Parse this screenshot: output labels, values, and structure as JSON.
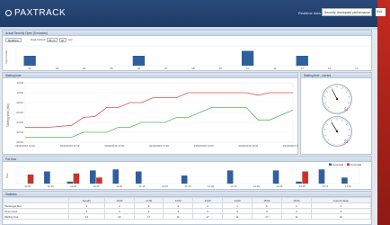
{
  "app": {
    "title": "PAXTRACK"
  },
  "header": {
    "realtime_label": "Realtime data",
    "select_value": "Security checkpoint performance",
    "exit_label": "Exit"
  },
  "controls": {
    "button_label": "Realtime",
    "time_label": "Data refresh",
    "time_value": "08:46",
    "interval_value": "60",
    "unit_label": "sec"
  },
  "panels": {
    "top_bar_title": "Actual Security Open (5 minutes)",
    "waiting_title": "Waiting time",
    "gauge_title": "Waiting time - current",
    "pax_title": "Pax flow",
    "stats_title": "Statistics"
  },
  "top_bar_chart": {
    "type": "bar",
    "ylabel": "Open lanes",
    "categories": [
      "02",
      "03",
      "04",
      "05",
      "06",
      "07",
      "08",
      "09",
      "10",
      "11",
      "12",
      "13",
      "14"
    ],
    "values": [
      4,
      0,
      0,
      0,
      4,
      0,
      0,
      0,
      6,
      0,
      4,
      0,
      0
    ],
    "ylim": [
      0,
      8
    ]
  },
  "waiting_chart": {
    "type": "line",
    "ylabel": "Waiting time (min)",
    "yticks": [
      "12:00",
      "10:00",
      "08:00",
      "06:00",
      "04:00",
      "02:00",
      "00:00"
    ],
    "xticks": [
      "03/02/2015 10:00",
      "03/02/2015 11:00",
      "03/02/2015 12:00",
      "03/02/2015 13:00",
      "03/02/2015 14:00",
      "03/02/2015 15:00",
      "03/02/2015 16:00"
    ],
    "ylim": [
      0,
      12
    ],
    "series": [
      {
        "color": "#d9534f",
        "values": [
          3,
          3,
          3,
          3.2,
          3.4,
          5,
          5.2,
          7,
          7,
          8,
          8,
          9,
          9,
          9,
          10,
          10,
          10,
          10,
          10,
          10,
          9.5,
          10,
          10,
          10
        ]
      },
      {
        "color": "#5cb85c",
        "values": [
          1,
          1,
          1,
          1,
          1,
          2,
          2,
          2,
          3,
          3,
          4,
          4,
          4,
          5,
          5,
          6,
          7,
          7,
          7,
          7,
          4.5,
          4.5,
          5.5,
          6.5
        ]
      }
    ]
  },
  "gauges": {
    "values": [
      24,
      23
    ]
  },
  "pax_chart": {
    "type": "bar",
    "ylabel": "Pax",
    "categories": [
      "10:00",
      "10:15",
      "10:30",
      "10:45",
      "11:00",
      "11:15",
      "11:30",
      "11:45",
      "12:00",
      "12:15",
      "12:30",
      "12:45",
      "13:00",
      "13:15",
      "13:30"
    ],
    "series": [
      {
        "name": "Terminal1",
        "color": "#2f5f9e",
        "values": [
          0,
          120,
          20,
          130,
          140,
          120,
          0,
          80,
          0,
          130,
          0,
          130,
          20,
          140,
          60
        ]
      },
      {
        "name": "Terminal2",
        "color": "#c8342a",
        "values": [
          90,
          0,
          100,
          60,
          0,
          0,
          0,
          0,
          0,
          0,
          0,
          0,
          120,
          0,
          0
        ]
      }
    ],
    "legend": [
      "Terminal1",
      "Terminal2"
    ]
  },
  "stats": {
    "columns": [
      "",
      "Sum(h)",
      "10:00",
      "11:00",
      "12:00",
      "13:00",
      "14:00",
      "15:00",
      "16:00",
      "Current Value"
    ],
    "rows": [
      [
        "Passenger flow",
        "1",
        "4",
        "4",
        "4",
        "4",
        "1",
        "1",
        "1",
        "1"
      ],
      [
        "Open lanes",
        "3",
        "3",
        "3",
        "3",
        "3",
        "3",
        "3",
        "3",
        "3"
      ],
      [
        "Waiting time",
        "13",
        "23",
        "17",
        "11",
        "17",
        "11",
        "17",
        "11",
        "10"
      ]
    ]
  }
}
